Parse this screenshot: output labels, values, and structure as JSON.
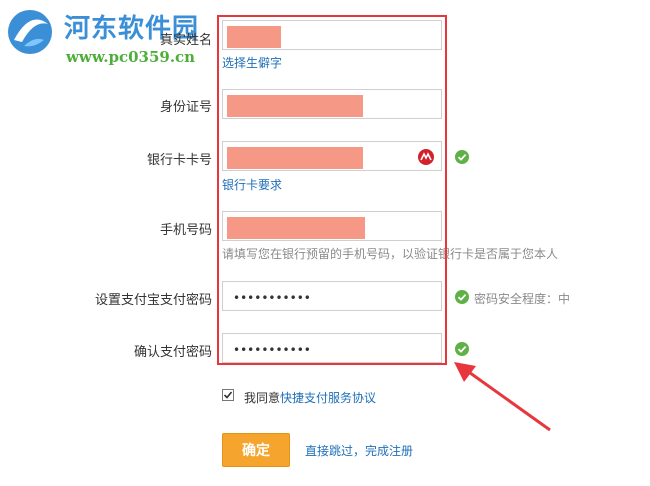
{
  "watermark": {
    "title": "河东软件园",
    "url": "www.pc0359.cn"
  },
  "form": {
    "name": {
      "label": "真实姓名",
      "link": "选择生僻字"
    },
    "id_number": {
      "label": "身份证号"
    },
    "bank_card": {
      "label": "银行卡卡号",
      "link": "银行卡要求",
      "badge_icon": "unionpay-icon"
    },
    "phone": {
      "label": "手机号码",
      "hint": "请填写您在银行预留的手机号码，以验证银行卡是否属于您本人"
    },
    "pay_password": {
      "label": "设置支付宝支付密码",
      "value": "•••••••••••",
      "strength": "密码安全程度：中"
    },
    "confirm_password": {
      "label": "确认支付密码",
      "value": "•••••••••••"
    }
  },
  "agreement": {
    "prefix": "我同意",
    "link": "快捷支付服务协议",
    "checked": true
  },
  "actions": {
    "submit": "确定",
    "skip": "直接跳过，完成注册"
  },
  "colors": {
    "highlight": "#e8363d",
    "redaction": "#f59885",
    "ok": "#5eb245",
    "submit": "#f5a42d",
    "link": "#1e6fb8"
  }
}
